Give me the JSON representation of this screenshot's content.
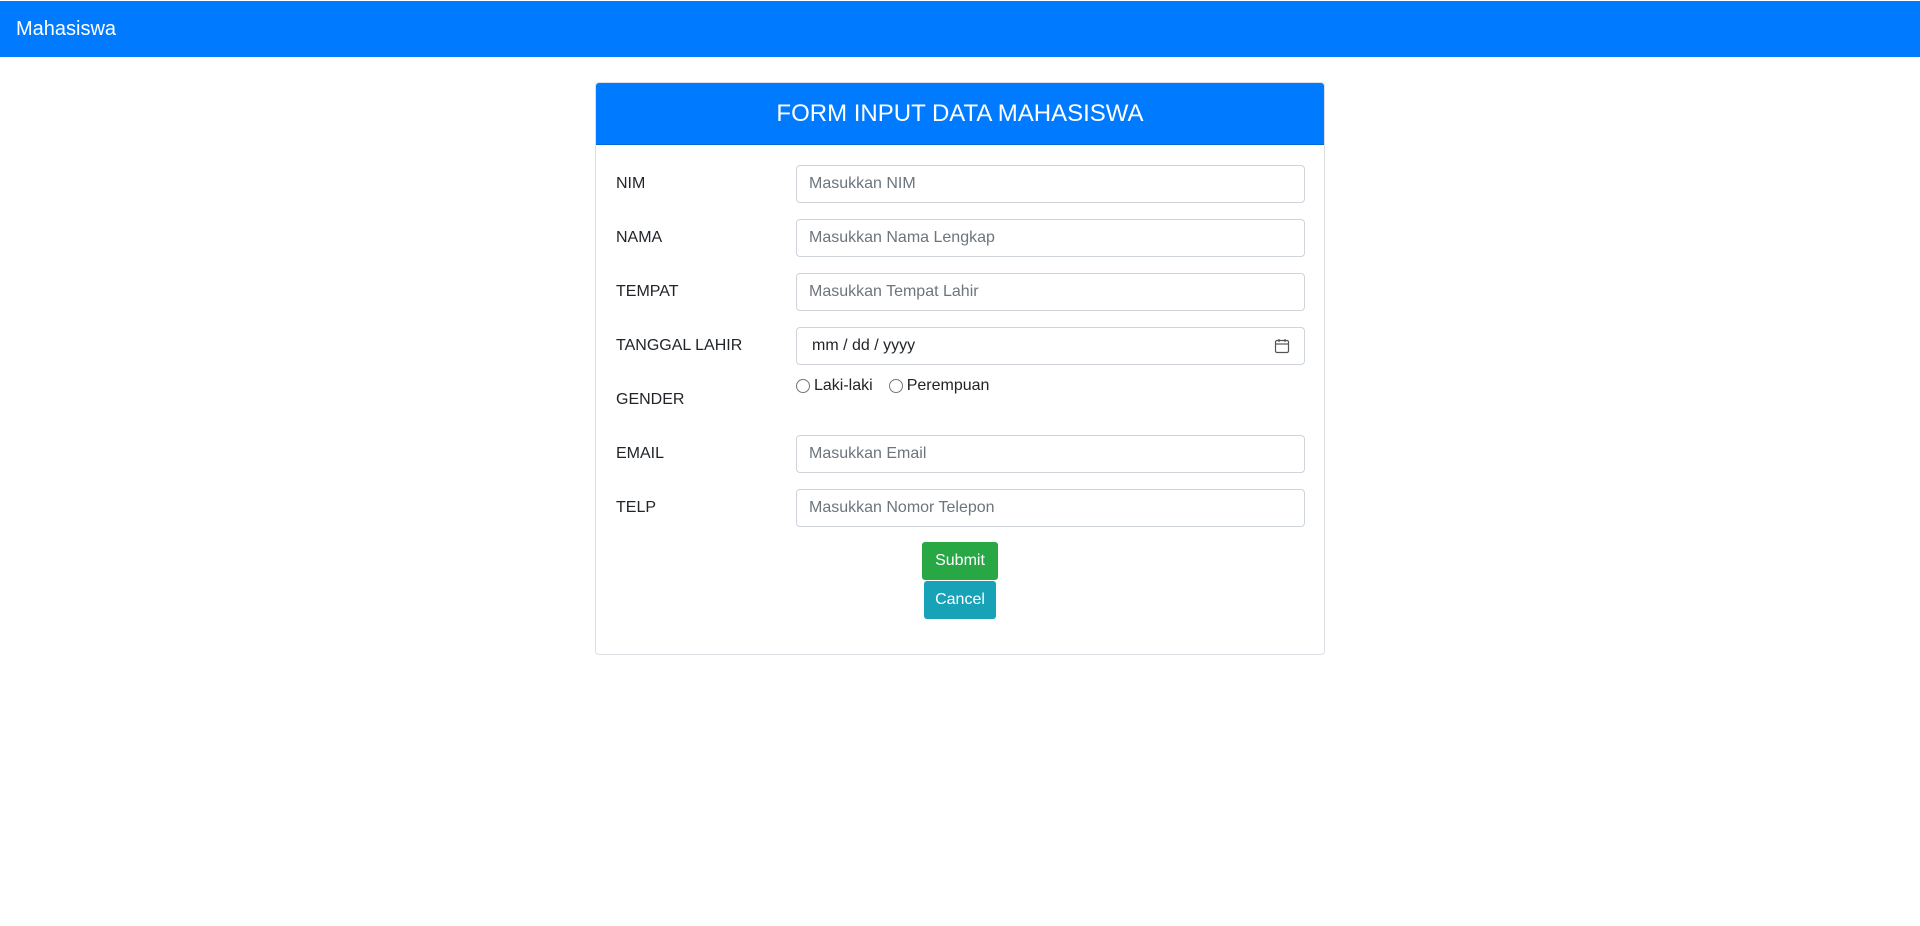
{
  "navbar": {
    "brand": "Mahasiswa"
  },
  "form": {
    "title": "FORM INPUT DATA MAHASISWA",
    "fields": {
      "nim": {
        "label": "NIM",
        "placeholder": "Masukkan NIM",
        "value": ""
      },
      "nama": {
        "label": "NAMA",
        "placeholder": "Masukkan Nama Lengkap",
        "value": ""
      },
      "tempat": {
        "label": "TEMPAT",
        "placeholder": "Masukkan Tempat Lahir",
        "value": ""
      },
      "tanggal_lahir": {
        "label": "TANGGAL LAHIR",
        "display": "mm / dd / yyyy",
        "icon": "calendar-icon"
      },
      "gender": {
        "label": "GENDER",
        "options": [
          "Laki-laki",
          "Perempuan"
        ],
        "selected": null
      },
      "email": {
        "label": "EMAIL",
        "placeholder": "Masukkan Email",
        "value": ""
      },
      "telp": {
        "label": "TELP",
        "placeholder": "Masukkan Nomor Telepon",
        "value": ""
      }
    },
    "buttons": {
      "submit": "Submit",
      "cancel": "Cancel"
    }
  },
  "colors": {
    "primary": "#007bff",
    "success": "#28a745",
    "info": "#17a2b8"
  }
}
